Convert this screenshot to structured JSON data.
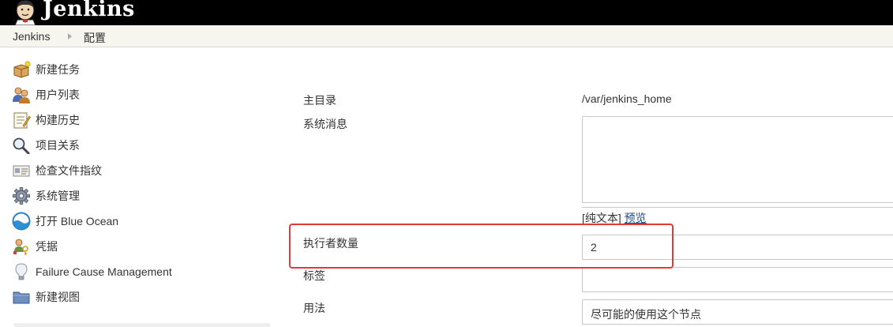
{
  "header": {
    "brand": "Jenkins",
    "logo_icon": "jenkins-butler-icon"
  },
  "breadcrumb": {
    "home": "Jenkins",
    "current": "配置"
  },
  "sidebar": {
    "items": [
      {
        "label": "新建任务",
        "icon": "new-package-icon"
      },
      {
        "label": "用户列表",
        "icon": "users-icon"
      },
      {
        "label": "构建历史",
        "icon": "notepad-icon"
      },
      {
        "label": "项目关系",
        "icon": "search-icon"
      },
      {
        "label": "检查文件指纹",
        "icon": "fingerprint-icon"
      },
      {
        "label": "系统管理",
        "icon": "gear-icon"
      },
      {
        "label": "打开 Blue Ocean",
        "icon": "blue-ocean-icon"
      },
      {
        "label": "凭据",
        "icon": "credentials-icon"
      },
      {
        "label": "Failure Cause Management",
        "icon": "lightbulb-icon"
      },
      {
        "label": "新建视图",
        "icon": "folder-icon"
      }
    ]
  },
  "form": {
    "home_dir_label": "主目录",
    "home_dir_value": "/var/jenkins_home",
    "system_message_label": "系统消息",
    "system_message_value": "",
    "mode_plain": "[纯文本]",
    "mode_preview": "预览",
    "executors_label": "执行者数量",
    "executors_value": "2",
    "labels_label": "标签",
    "labels_value": "",
    "usage_label": "用法",
    "usage_value": "尽可能的使用这个节点"
  },
  "colors": {
    "header_bg": "#000000",
    "breadcrumb_bg": "#f6f6ef",
    "highlight": "#e53935",
    "link": "#204a87"
  }
}
